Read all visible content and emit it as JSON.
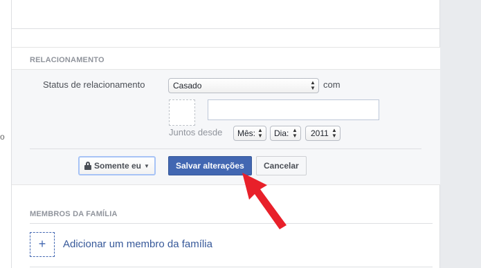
{
  "left_strip": {
    "text": "o"
  },
  "relationship": {
    "section_title": "RELACIONAMENTO",
    "status_label": "Status de relacionamento",
    "status_value": "Casado",
    "with_label": "com",
    "partner_value": "",
    "together_since_label": "Juntos desde",
    "month_value": "Mês:",
    "day_value": "Dia:",
    "year_value": "2011"
  },
  "actions": {
    "privacy_label": "Somente eu",
    "save_label": "Salvar alterações",
    "cancel_label": "Cancelar"
  },
  "family": {
    "section_title": "MEMBROS DA FAMÍLIA",
    "add_symbol": "+",
    "add_label": "Adicionar um membro da família"
  },
  "icons": {
    "lock": "lock-icon",
    "caret": "caret-down-icon",
    "arrow": "red-arrow-annotation",
    "plus": "plus-icon"
  },
  "colors": {
    "primary": "#4267b2",
    "arrow": "#e8202a",
    "link": "#365899"
  }
}
